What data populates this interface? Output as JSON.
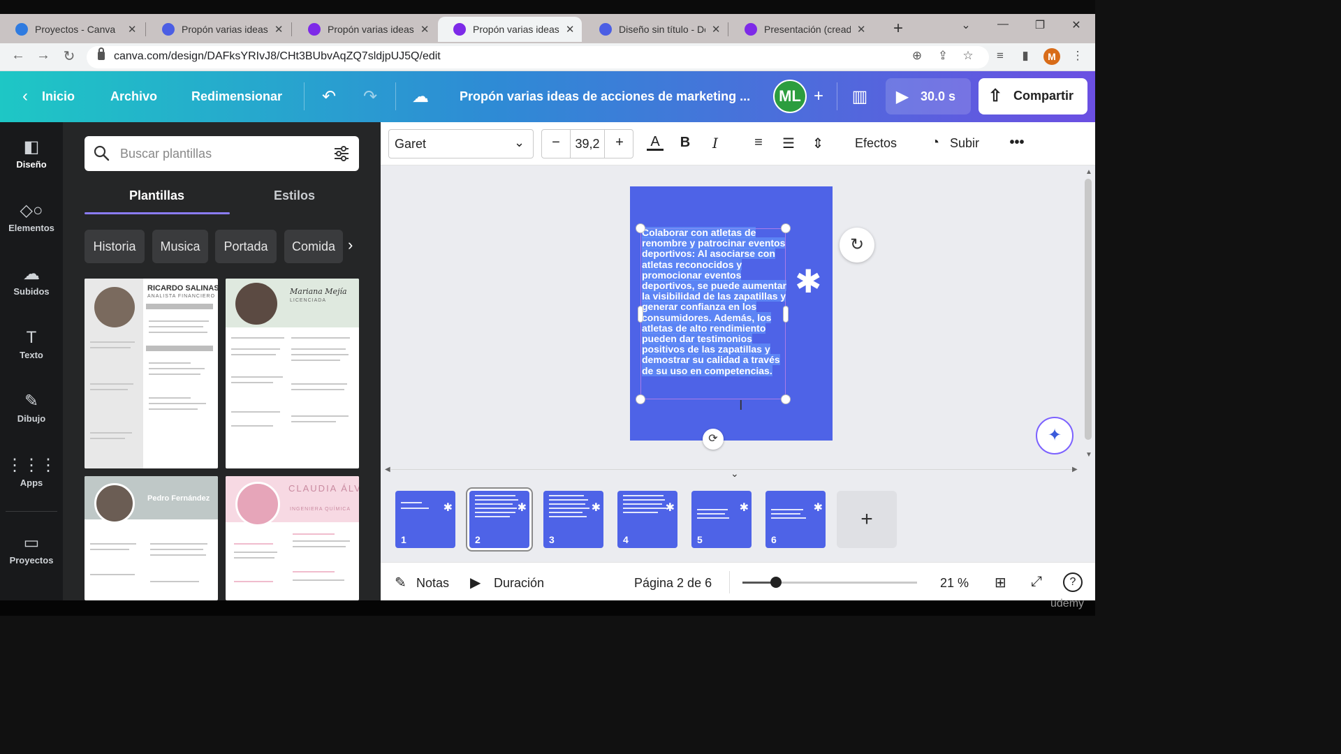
{
  "browser": {
    "tabs": [
      {
        "label": "Proyectos - Canva",
        "color": "#2f7be0"
      },
      {
        "label": "Propón varias ideas de",
        "color": "#4b5ee4"
      },
      {
        "label": "Propón varias ideas de",
        "color": "#7d2ae8"
      },
      {
        "label": "Propón varias ideas de",
        "color": "#7d2ae8"
      },
      {
        "label": "Diseño sin título - Do",
        "color": "#4b5ee4"
      },
      {
        "label": "Presentación (creada",
        "color": "#7d2ae8"
      }
    ],
    "active_tab_index": 3,
    "url": "canva.com/design/DAFksYRIvJ8/CHt3BUbvAqZQ7sldjpUJ5Q/edit",
    "profile_initial": "M"
  },
  "header": {
    "home": "Inicio",
    "file": "Archivo",
    "resize": "Redimensionar",
    "title": "Propón varias ideas de acciones de marketing ...",
    "avatar": "ML",
    "timer": "30.0 s",
    "share": "Compartir"
  },
  "rail": [
    {
      "label": "Diseño",
      "icon": "design-icon"
    },
    {
      "label": "Elementos",
      "icon": "elements-icon"
    },
    {
      "label": "Subidos",
      "icon": "uploads-icon"
    },
    {
      "label": "Texto",
      "icon": "text-icon"
    },
    {
      "label": "Dibujo",
      "icon": "draw-icon"
    },
    {
      "label": "Apps",
      "icon": "apps-icon"
    },
    {
      "label": "Proyectos",
      "icon": "projects-icon"
    }
  ],
  "panel": {
    "search_placeholder": "Buscar plantillas",
    "tabs": [
      "Plantillas",
      "Estilos"
    ],
    "chips": [
      "Historia",
      "Musica",
      "Portada",
      "Comida"
    ],
    "templates": [
      {
        "name": "RICARDO SALINAS",
        "subtitle": "ANALISTA FINANCIERO"
      },
      {
        "name": "Mariana Mejía",
        "subtitle": "LICENCIADA"
      },
      {
        "name": "Pedro Fernández",
        "subtitle": ""
      },
      {
        "name": "CLAUDIA ÁLVAREZ",
        "subtitle": "INGENIERA QUÍMICA"
      }
    ]
  },
  "toolbar": {
    "font": "Garet",
    "font_size": "39,2",
    "effects": "Efectos",
    "animate": "Subir"
  },
  "canvas": {
    "text": "Colaborar con atletas de renombre y patrocinar eventos deportivos: Al asociarse con atletas reconocidos y promocionar eventos deportivos, se puede aumentar la visibilidad de las zapatillas y generar confianza en los consumidores. Además, los atletas de alto rendimiento pueden dar testimonios positivos de las zapatillas y demostrar su calidad a través de su uso en competencias.",
    "page_color": "#4e63e7"
  },
  "pages": [
    "1",
    "2",
    "3",
    "4",
    "5",
    "6"
  ],
  "selected_page_index": 1,
  "bottom": {
    "notes": "Notas",
    "duration": "Duración",
    "page_indicator": "Página 2 de 6",
    "zoom": "21 %",
    "zoom_fraction": 0.19
  },
  "watermark": "udemy"
}
